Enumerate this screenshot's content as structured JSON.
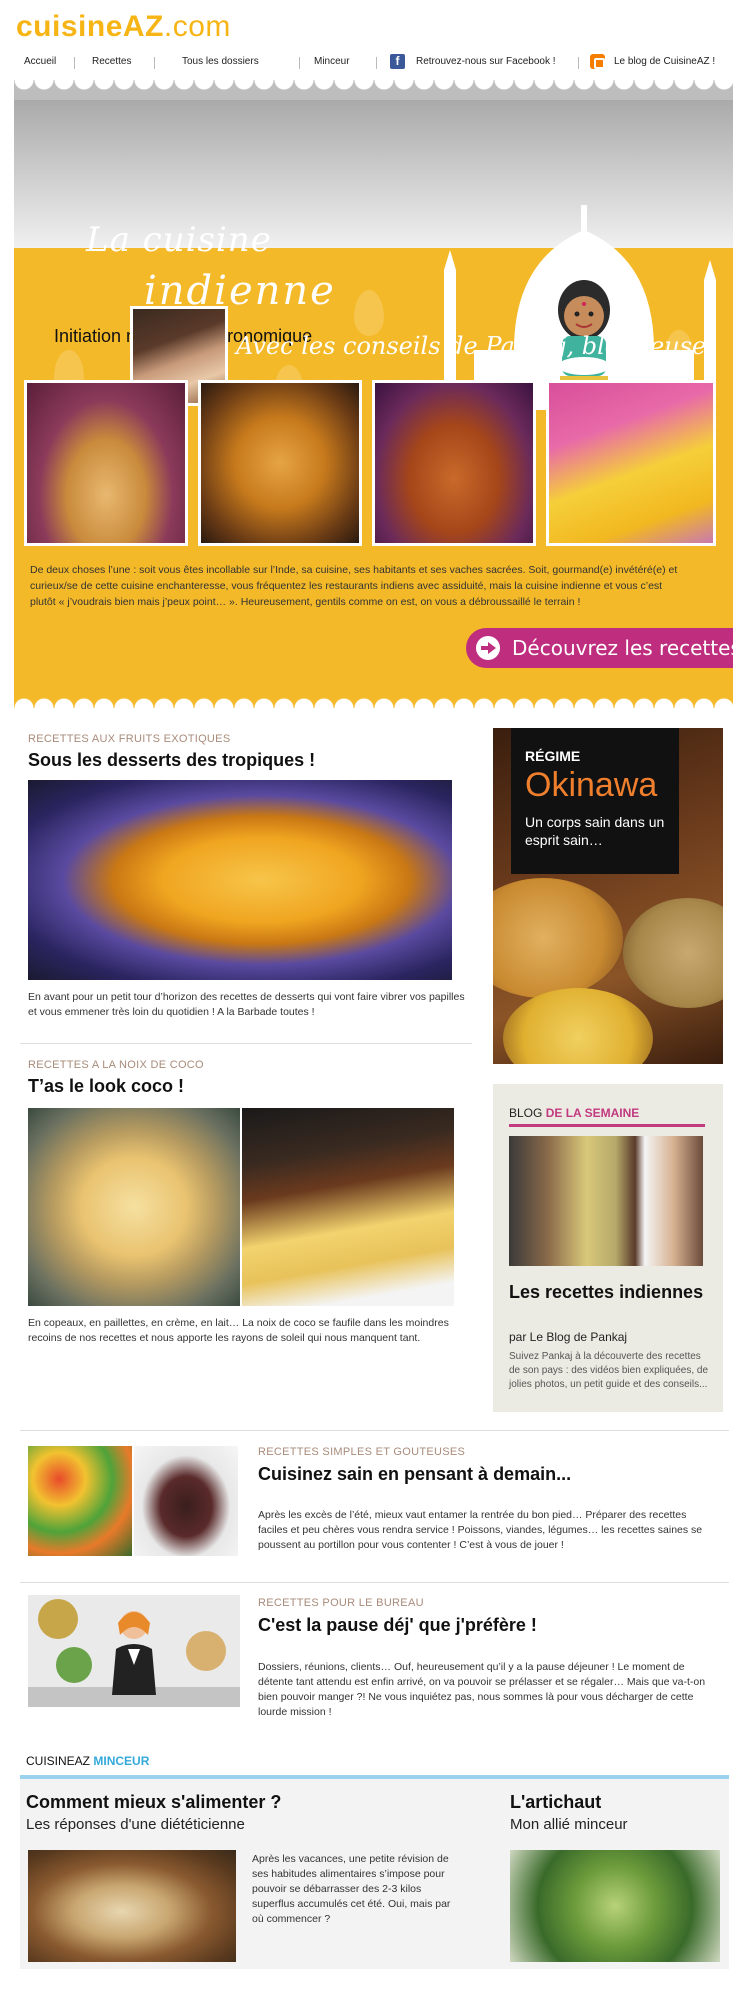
{
  "logo": {
    "part1": "cuisineAZ",
    "part2": ".com"
  },
  "nav": {
    "accueil": "Accueil",
    "recettes": "Recettes",
    "dossiers": "Tous les dossiers",
    "minceur": "Minceur",
    "facebook": "Retrouvez-nous sur Facebook !",
    "blog": "Le blog de CuisineAZ !"
  },
  "banner": {
    "title_line1": "La cuisine",
    "title_line2": "indienne",
    "subtitle": "Initiation mystico-gastronomique",
    "conseils": "Avec les conseils de Pankaj, blogueuse",
    "text": "De deux choses l’une : soit vous êtes incollable sur l’Inde, sa cuisine, ses habitants et ses vaches sacrées. Soit, gourmand(e) invétéré(e) et curieux/se de cette cuisine enchanteresse, vous fréquentez les restaurants indiens avec assiduité, mais la cuisine indienne et vous c’est plutôt « j’voudrais bien mais j’peux point… ». Heureusement, gentils comme on est, on vous a débroussaillé le terrain !",
    "cta": "Découvrez les recettes"
  },
  "articles": {
    "a1": {
      "kicker": "RECETTES AUX FRUITS EXOTIQUES",
      "title": "Sous les desserts des tropiques !",
      "text": "En avant pour un petit tour d’horizon des recettes de desserts qui vont faire vibrer vos papilles et vous emmener très loin du quotidien ! A la Barbade toutes !"
    },
    "a2": {
      "kicker": "RECETTES A LA NOIX DE COCO",
      "title": "T’as le look coco !",
      "text": "En copeaux, en paillettes, en crème, en lait… La noix de coco se faufile dans les moindres recoins de nos recettes et nous apporte les rayons de soleil qui nous manquent tant."
    },
    "a3": {
      "kicker": "RECETTES SIMPLES ET GOUTEUSES",
      "title": "Cuisinez sain en pensant à demain...",
      "text": "Après les excès de l’été, mieux vaut entamer la rentrée du bon pied… Préparer des recettes faciles et peu chères vous rendra service ! Poissons, viandes, légumes… les recettes saines se poussent au portillon pour vous contenter ! C’est à vous de jouer !"
    },
    "a4": {
      "kicker": "RECETTES POUR LE BUREAU",
      "title": "C'est la pause déj' que j'préfère !",
      "text": "Dossiers, réunions, clients… Ouf, heureusement qu’il y a la pause déjeuner ! Le moment de détente tant attendu est enfin arrivé, on va pouvoir se prélasser et se régaler… Mais que va-t-on bien pouvoir manger ?! Ne vous inquiétez pas, nous sommes là pour vous décharger de cette lourde mission !"
    }
  },
  "okinawa": {
    "line1": "RÉGIME",
    "line2": "Okinawa",
    "line3": "Un corps sain dans un esprit sain…"
  },
  "blog": {
    "label_a": "BLOG",
    "label_b": "DE LA SEMAINE",
    "title": "Les recettes indiennes",
    "by": "par Le Blog de Pankaj",
    "text": "Suivez Pankaj à la découverte des recettes de son pays : des vidéos bien expliquées, de jolies photos, un petit guide et des conseils..."
  },
  "minceur": {
    "label_a": "CUISINEAZ",
    "label_b": "MINCEUR",
    "left_title": "Comment mieux s'alimenter ?",
    "left_sub": "Les réponses d'une diététicienne",
    "left_text": "Après les vacances, une petite révision de ses habitudes alimentaires s’impose pour pouvoir se débarrasser des 2-3 kilos superflus accumulés cet été. Oui, mais par où commencer ?",
    "right_title": "L'artichaut",
    "right_sub": "Mon allié minceur"
  },
  "colors": {
    "brand_yellow": "#f6b515",
    "banner_yellow": "#f4b928",
    "cta_magenta": "#bf2d7e",
    "okinawa_orange": "#f07f2d",
    "minceur_blue": "#35a9d9"
  }
}
